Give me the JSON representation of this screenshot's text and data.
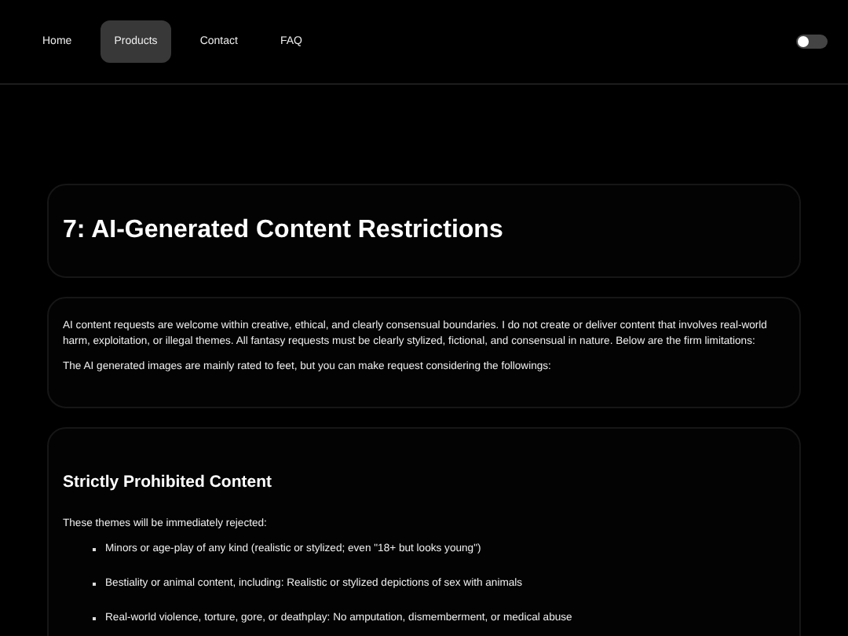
{
  "nav": {
    "items": [
      {
        "label": "Home",
        "selected": false
      },
      {
        "label": "Products",
        "selected": true
      },
      {
        "label": "Contact",
        "selected": false
      },
      {
        "label": "FAQ",
        "selected": false
      }
    ],
    "theme_toggle": {
      "on": false
    }
  },
  "title_card": {
    "title": "7: AI-Generated Content Restrictions"
  },
  "intro_card": {
    "paragraphs": [
      "AI content requests are welcome within creative, ethical, and clearly consensual boundaries. I do not create or deliver content that involves real-world harm, exploitation, or illegal themes. All fantasy requests must be clearly stylized, fictional, and consensual in nature. Below are the firm limitations:",
      "The AI generated images are mainly rated to feet, but you can make request considering the followings:"
    ]
  },
  "prohibited_card": {
    "heading": "Strictly Prohibited Content",
    "lead": "These themes will be immediately rejected:",
    "items": [
      "Minors or age-play of any kind (realistic or stylized; even \"18+ but looks young\")",
      "Bestiality or animal content, including: Realistic or stylized depictions of sex with animals",
      "Real-world violence, torture, gore, or deathplay: No amputation, dismemberment, or medical abuse"
    ]
  }
}
